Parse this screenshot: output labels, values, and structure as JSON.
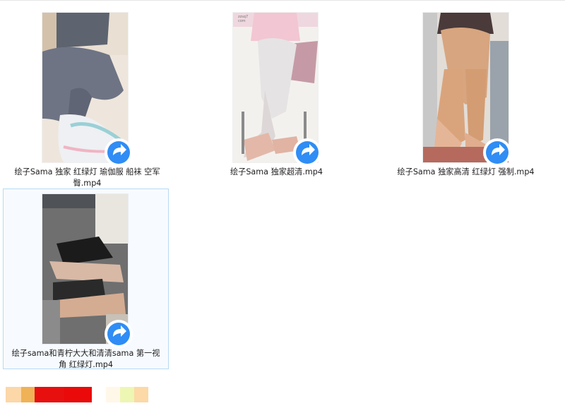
{
  "files": [
    {
      "name": "绘子Sama 独家 红绿灯 瑜伽服 船袜 空军 臀.mp4",
      "type": "mp4-video",
      "selected": false
    },
    {
      "name": "绘子Sama 独家超清.mp4",
      "type": "mp4-video",
      "selected": false
    },
    {
      "name": "绘子Sama 独家高清 红绿灯 强制.mp4",
      "type": "mp4-video",
      "selected": false
    },
    {
      "name": "绘子sama和青柠大大和清清sama 第一视角 红绿灯.mp4",
      "type": "mp4-video",
      "selected": true
    }
  ],
  "thumbnail_watermark": "zzsq7\ncom",
  "badge_icon": "video-player-play-arrow-icon",
  "colors": {
    "selection_bg": "#f7fbff",
    "selection_border": "#b6dbf3",
    "badge_blue": "#2f8df5",
    "swatch_strip": [
      "#fcd7a8",
      "#f0b256",
      "#e80f0f",
      "#ea0a0a",
      "#ffffff",
      "#fff7e8",
      "#eef6b3",
      "#fcd9a6"
    ]
  }
}
